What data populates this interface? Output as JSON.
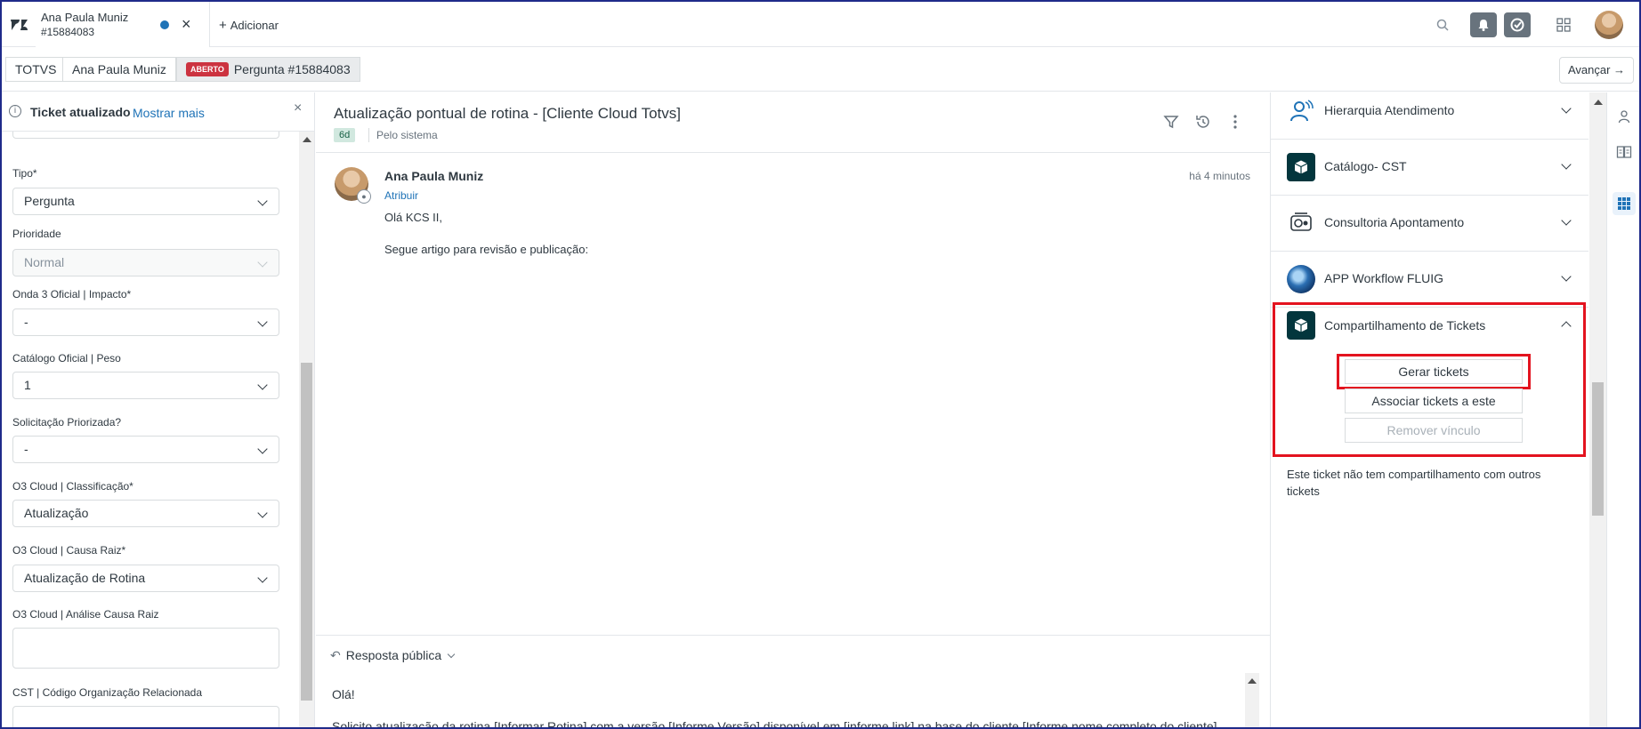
{
  "topbar": {
    "tab_title": "Ana Paula Muniz",
    "tab_sub": "#15884083",
    "add_label": "Adicionar"
  },
  "breadcrumb": {
    "org": "TOTVS",
    "user": "Ana Paula Muniz",
    "status_badge": "ABERTO",
    "ticket": "Pergunta #15884083",
    "advance_label": "Avançar"
  },
  "notice": {
    "text": "Ticket atualizado",
    "link": "Mostrar mais"
  },
  "fields": [
    {
      "label": "Tipo*",
      "value": "Pergunta",
      "disabled": false
    },
    {
      "label": "Prioridade",
      "value": "Normal",
      "disabled": true
    },
    {
      "label": "Onda 3 Oficial | Impacto*",
      "value": "-",
      "disabled": false
    },
    {
      "label": "Catálogo Oficial | Peso",
      "value": "1",
      "disabled": false
    },
    {
      "label": "Solicitação Priorizada?",
      "value": "-",
      "disabled": false
    },
    {
      "label": "O3 Cloud | Classificação*",
      "value": "Atualização",
      "disabled": false
    },
    {
      "label": "O3 Cloud | Causa Raiz*",
      "value": "Atualização de Rotina",
      "disabled": false
    }
  ],
  "textfields": [
    {
      "label": "O3 Cloud | Análise Causa Raiz"
    },
    {
      "label": "CST | Código Organização Relacionada"
    }
  ],
  "conversation": {
    "title": "Atualização pontual de rotina - [Cliente Cloud Totvs]",
    "age": "6d",
    "via": "Pelo sistema",
    "message": {
      "author": "Ana Paula Muniz",
      "time": "há 4 minutos",
      "assign": "Atribuir",
      "line1": "Olá KCS II,",
      "line2": "Segue artigo para revisão e publicação:"
    },
    "reply": {
      "type": "Resposta pública",
      "line1": "Olá!",
      "line2": "Solicito atualização da rotina [Informar Rotina] com a versão [Informe Versão] disponível em [informe link] na base do cliente [Informe nome completo do cliente]"
    }
  },
  "apps": {
    "items": [
      {
        "name": "Hierarquia Atendimento",
        "icon": "hierarchy-icon"
      },
      {
        "name": "Catálogo- CST",
        "icon": "cube-icon"
      },
      {
        "name": "Consultoria Apontamento",
        "icon": "consulting-icon"
      },
      {
        "name": "APP Workflow FLUIG",
        "icon": "fluig-icon"
      },
      {
        "name": "Compartilhamento de Tickets",
        "icon": "cube-icon"
      }
    ],
    "share": {
      "generate": "Gerar tickets",
      "associate": "Associar tickets a este",
      "remove": "Remover vínculo",
      "note": "Este ticket não tem compartilhamento com outros tickets"
    }
  },
  "colors": {
    "accent": "#1f73b7",
    "highlight": "#e3131f",
    "badge": "#cc3340",
    "app_dark": "#03363d"
  }
}
